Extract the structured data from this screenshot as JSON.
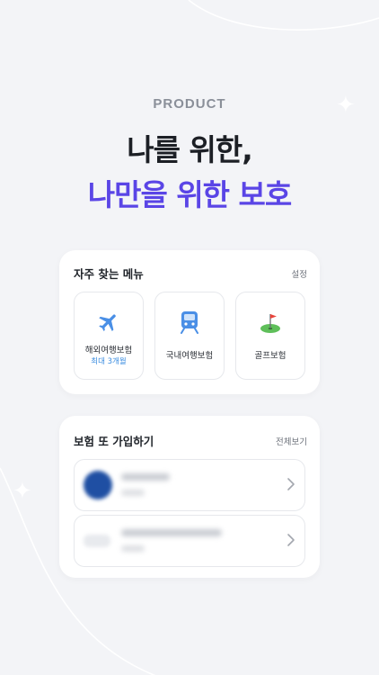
{
  "header": {
    "eyebrow": "PRODUCT",
    "headline_line1": "나를 위한,",
    "headline_line2": "나만을 위한 보호"
  },
  "colors": {
    "background": "#f3f4f7",
    "accent": "#5a45e6",
    "link_blue": "#3b8de0"
  },
  "frequent_menu": {
    "title": "자주 찾는 메뉴",
    "action": "설정",
    "items": [
      {
        "icon": "airplane-icon",
        "label": "해외여행보험",
        "sub": "최대 3개월"
      },
      {
        "icon": "train-icon",
        "label": "국내여행보험",
        "sub": ""
      },
      {
        "icon": "golf-icon",
        "label": "골프보험",
        "sub": ""
      }
    ]
  },
  "reenroll": {
    "title": "보험 또 가입하기",
    "action": "전체보기"
  }
}
